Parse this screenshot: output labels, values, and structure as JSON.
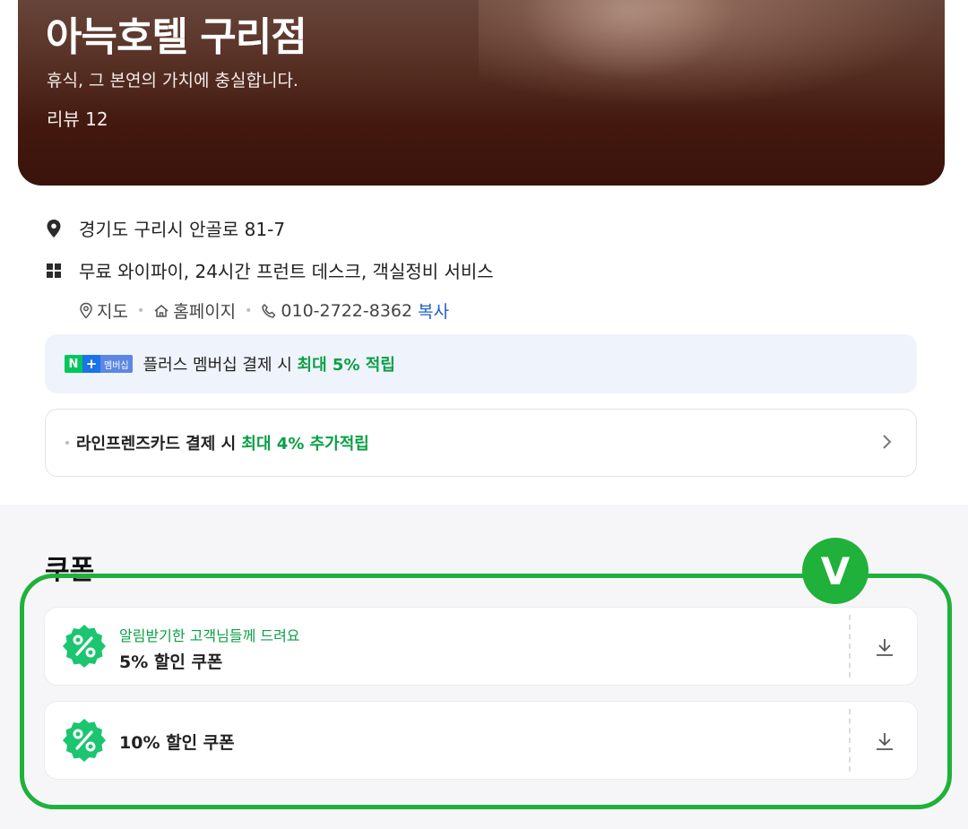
{
  "hero": {
    "title": "아늑호텔 구리점",
    "subtitle": "휴식, 그 본연의 가치에 충실합니다.",
    "review": "리뷰 12"
  },
  "info": {
    "address": "경기도 구리시 안골로 81-7",
    "amenities": "무료 와이파이, 24시간 프런트 데스크, 객실정비 서비스"
  },
  "links": {
    "map": "지도",
    "homepage": "홈페이지",
    "phone": "010-2722-8362",
    "copy": "복사"
  },
  "membership": {
    "badge_n": "N",
    "badge_plus": "+",
    "badge_label": "멤버십",
    "text_prefix": "플러스 멤버십 결제 시 ",
    "text_highlight": "최대 5% 적립"
  },
  "card_promo": {
    "text_prefix": "라인프렌즈카드 결제 시 ",
    "text_highlight": "최대 4% 추가적립"
  },
  "coupons": {
    "section_title": "쿠폰",
    "items": [
      {
        "note": "알림받기한 고객님들께 드려요",
        "title": "5% 할인 쿠폰"
      },
      {
        "note": "",
        "title": "10% 할인 쿠폰"
      }
    ]
  },
  "annotation": {
    "mark": "V"
  },
  "colors": {
    "accent_green": "#0a9f45",
    "highlight_green": "#1fb13a",
    "link_blue": "#2260c9"
  }
}
